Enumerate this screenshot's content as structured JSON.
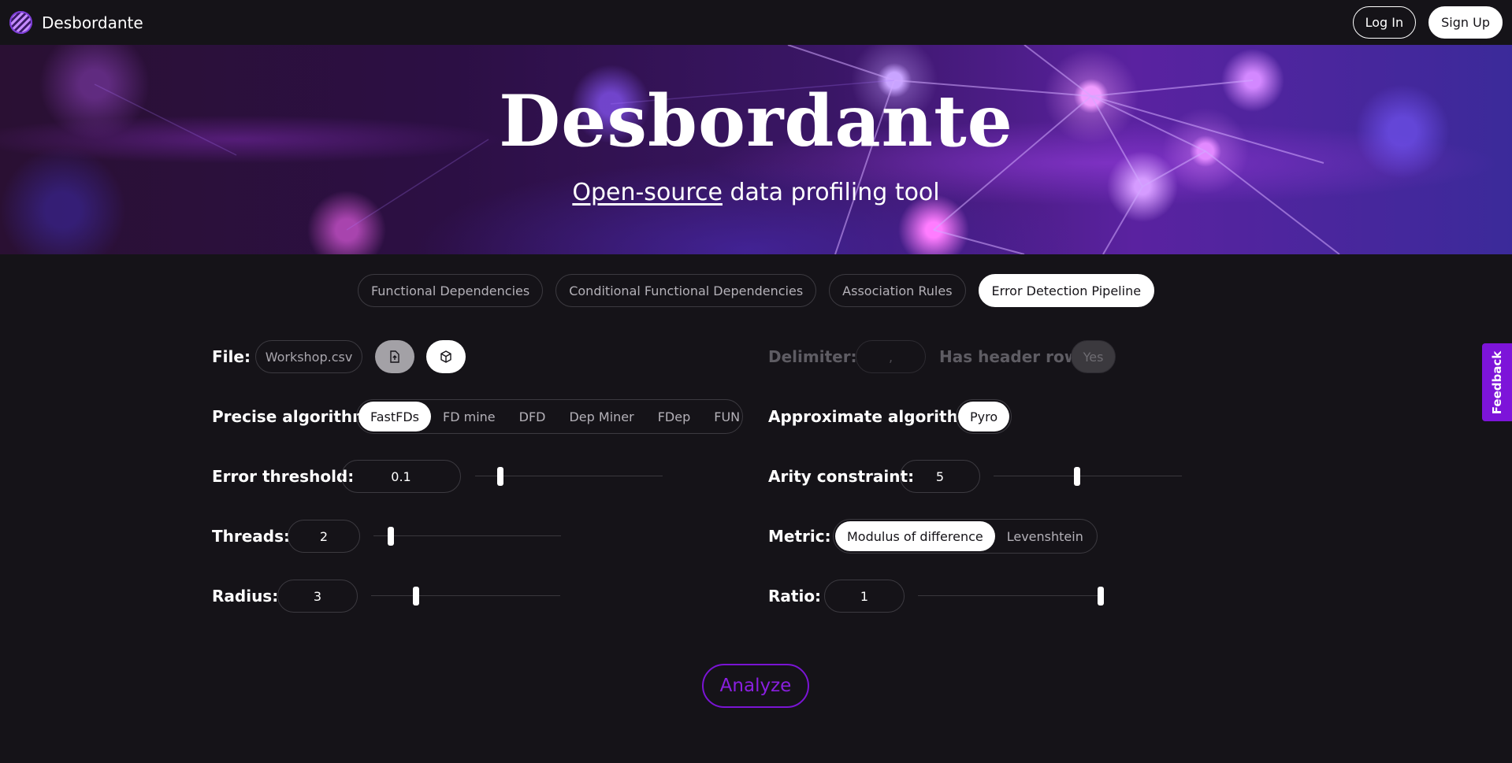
{
  "header": {
    "brand": "Desbordante",
    "login_label": "Log In",
    "signup_label": "Sign Up"
  },
  "hero": {
    "title": "Desbordante",
    "subtitle_link": "Open-source",
    "subtitle_rest": " data profiling tool"
  },
  "tabs": [
    {
      "label": "Functional Dependencies",
      "active": false
    },
    {
      "label": "Conditional Functional Dependencies",
      "active": false
    },
    {
      "label": "Association Rules",
      "active": false
    },
    {
      "label": "Error Detection Pipeline",
      "active": true
    }
  ],
  "form": {
    "file": {
      "label": "File:",
      "value": "Workshop.csv",
      "upload_icon": "file-upload-icon",
      "builtin_icon": "cube-icon"
    },
    "delimiter": {
      "label": "Delimiter:",
      "value": ","
    },
    "header_row": {
      "label": "Has header row:",
      "value": "Yes"
    },
    "precise_algorithm": {
      "label": "Precise algorithm:",
      "options": [
        "FastFDs",
        "FD mine",
        "DFD",
        "Dep Miner",
        "FDep",
        "FUN"
      ],
      "selected": "FastFDs"
    },
    "approximate_algorithm": {
      "label": "Approximate algorithm:",
      "options": [
        "Pyro"
      ],
      "selected": "Pyro"
    },
    "error_threshold": {
      "label": "Error threshold:",
      "value": "0.1",
      "level": 0.12
    },
    "arity_constraint": {
      "label": "Arity constraint:",
      "value": "5",
      "level": 0.44
    },
    "threads": {
      "label": "Threads:",
      "value": "2",
      "level": 0.08
    },
    "metric": {
      "label": "Metric:",
      "options": [
        "Modulus of difference",
        "Levenshtein"
      ],
      "selected": "Modulus of difference"
    },
    "radius": {
      "label": "Radius:",
      "value": "3",
      "level": 0.23
    },
    "ratio": {
      "label": "Ratio:",
      "value": "1",
      "level": 1.0
    },
    "analyze_label": "Analyze"
  },
  "feedback_label": "Feedback",
  "colors": {
    "background": "#151318",
    "accent": "#7a14d4",
    "text": "#ffffff",
    "muted": "#b4b1b8"
  }
}
